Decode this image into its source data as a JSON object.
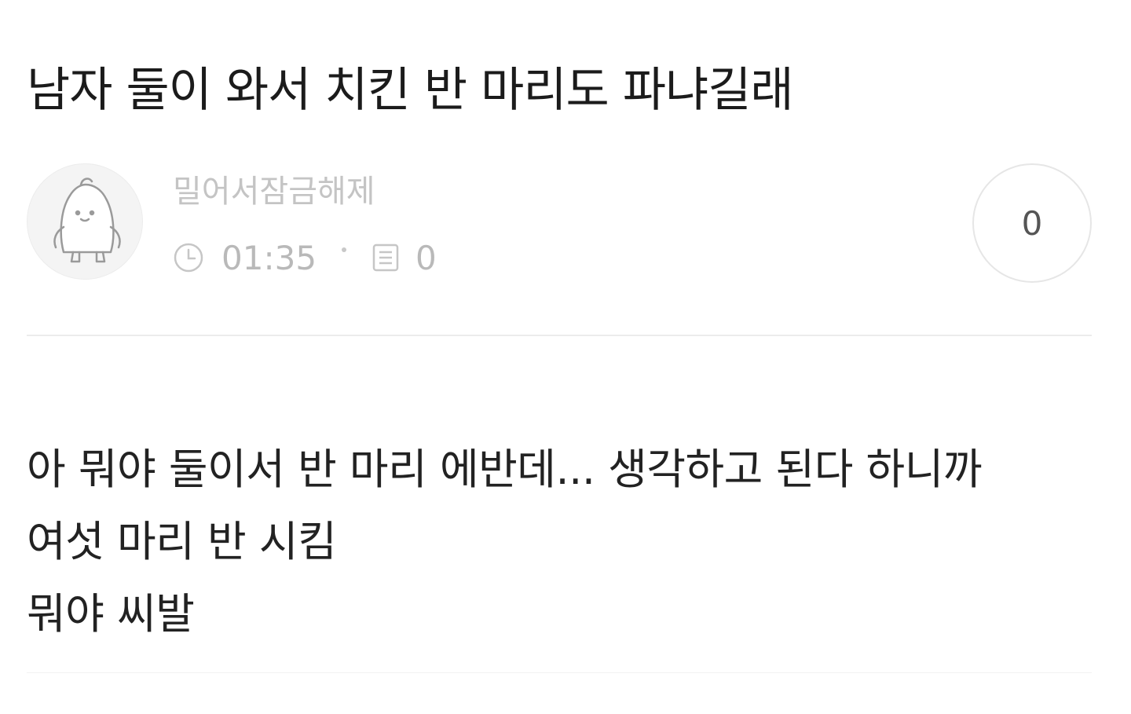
{
  "post": {
    "title": "남자 둘이 와서 치킨 반 마리도 파냐길래",
    "author": {
      "name": "밀어서잠금해제",
      "avatar_icon": "penguin-avatar-icon"
    },
    "meta": {
      "time_icon": "clock-icon",
      "time": "01:35",
      "comment_icon": "comment-icon",
      "comment_count": "0"
    },
    "like_count": "0",
    "body_lines": [
      "아 뭐야 둘이서 반 마리 에반데... 생각하고 된다 하니까",
      "여섯 마리 반 시킴",
      "뭐야 씨발"
    ]
  },
  "colors": {
    "title": "#1b1b1b",
    "muted": "#b9b9b9",
    "body": "#222222",
    "divider": "#ececec"
  }
}
